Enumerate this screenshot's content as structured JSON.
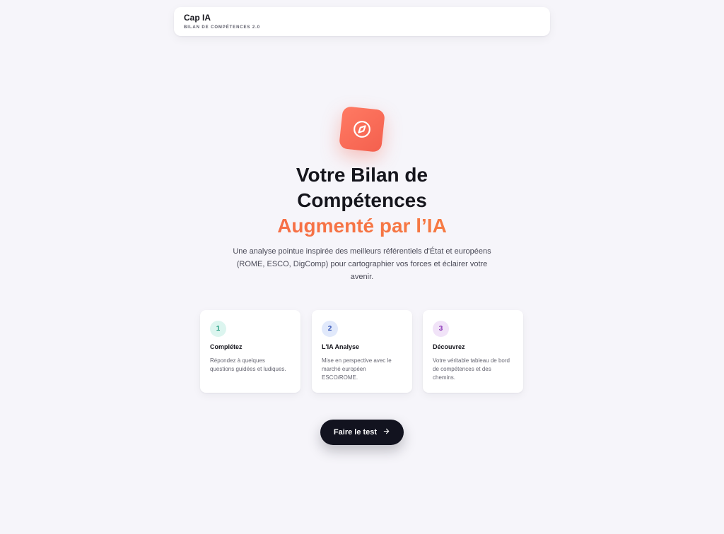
{
  "header": {
    "brand_title": "Cap IA",
    "brand_subtitle": "BILAN DE COMPÉTENCES 2.0"
  },
  "hero": {
    "icon": "compass-icon",
    "title_line1": "Votre Bilan de",
    "title_line2": "Compétences",
    "title_accent": "Augmenté par l’IA",
    "description": "Une analyse pointue inspirée des meilleurs référentiels d'État et européens (ROME, ESCO, DigComp) pour cartographier vos forces et éclairer votre avenir."
  },
  "steps": [
    {
      "number": "1",
      "title": "Complétez",
      "text": "Répondez à quelques questions guidées et ludiques.",
      "badge_bg": "#dcf5ef",
      "badge_color": "#1f9b7e"
    },
    {
      "number": "2",
      "title": "L'IA Analyse",
      "text": "Mise en perspective avec le marché européen ESCO/ROME.",
      "badge_bg": "#e1e9fb",
      "badge_color": "#3455b8"
    },
    {
      "number": "3",
      "title": "Découvrez",
      "text": "Votre véritable tableau de bord de compétences et des chemins.",
      "badge_bg": "#f1e3f8",
      "badge_color": "#8a35b5"
    }
  ],
  "cta": {
    "label": "Faire le test",
    "icon": "arrow-right-icon"
  },
  "colors": {
    "accent": "#f4604e",
    "accent_gradient_end": "#f88a3c",
    "cta_bg": "#12131f",
    "page_bg": "#f6f5fa"
  }
}
